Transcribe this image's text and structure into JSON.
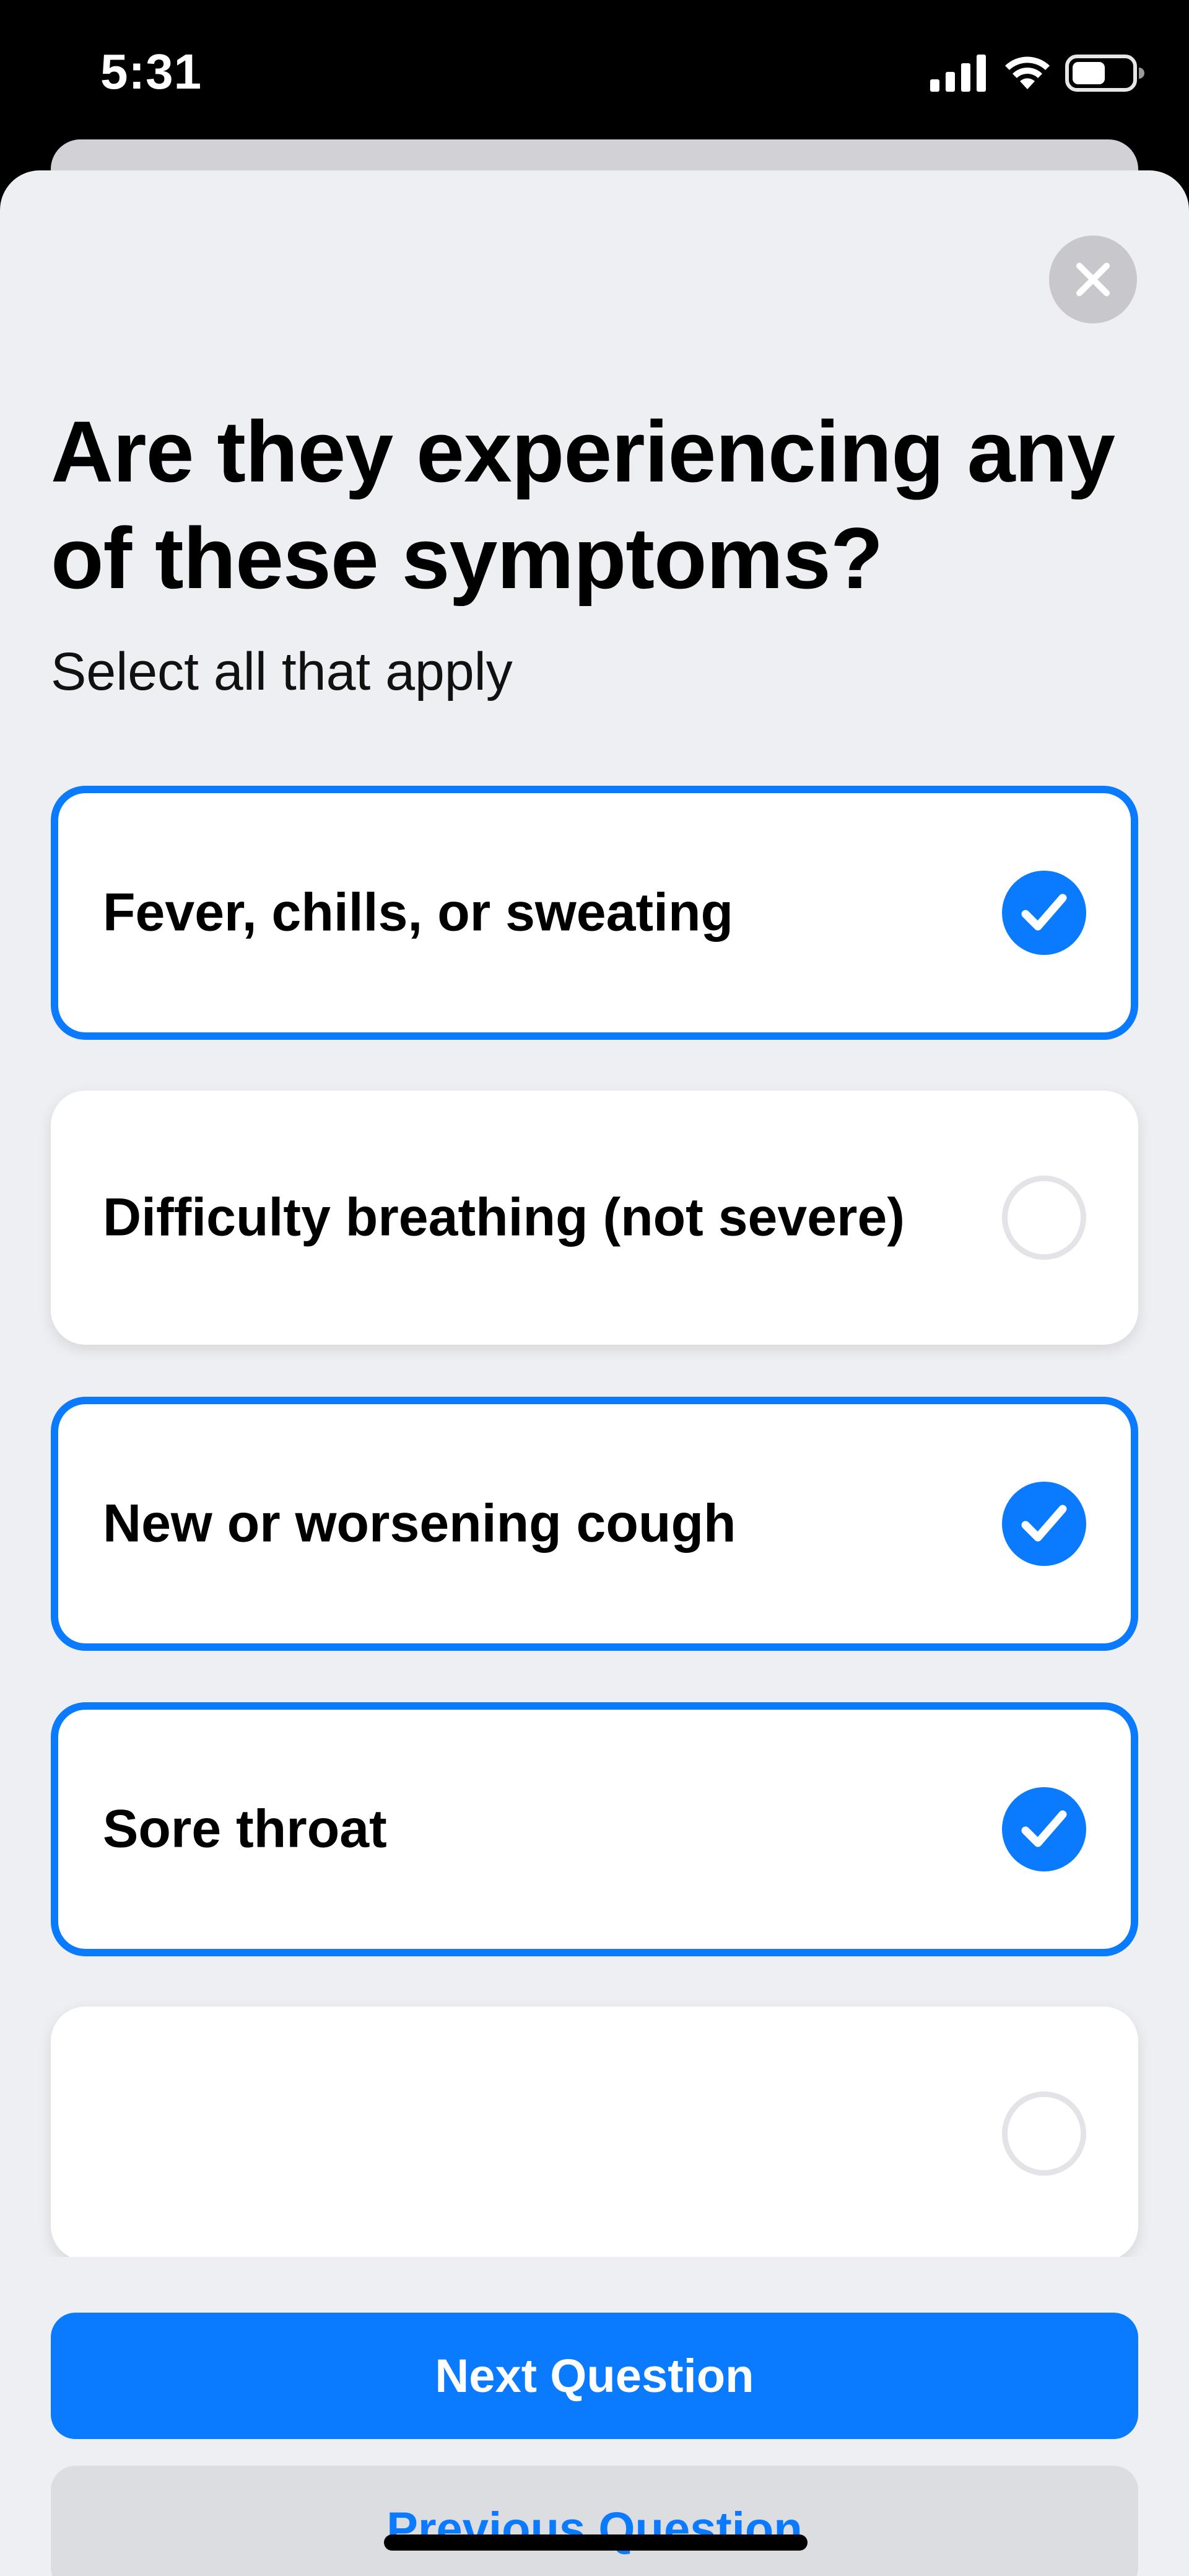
{
  "status_bar": {
    "time": "5:31",
    "icons": [
      "cellular-signal-icon",
      "wifi-icon",
      "battery-icon"
    ]
  },
  "sheet": {
    "close_icon": "close-icon",
    "title": "Are they experiencing any of these symptoms?",
    "subtitle": "Select all that apply",
    "options": [
      {
        "label": "Fever, chills, or sweating",
        "selected": true
      },
      {
        "label": "Difficulty breathing (not severe)",
        "selected": false
      },
      {
        "label": "New or worsening cough",
        "selected": true
      },
      {
        "label": "Sore throat",
        "selected": true
      },
      {
        "label": "",
        "selected": false
      }
    ]
  },
  "actions": {
    "next_label": "Next Question",
    "previous_label": "Previous Question"
  },
  "colors": {
    "accent": "#0a7aff",
    "sheet_background": "#eeeff2",
    "secondary_button": "#dcdde1"
  }
}
